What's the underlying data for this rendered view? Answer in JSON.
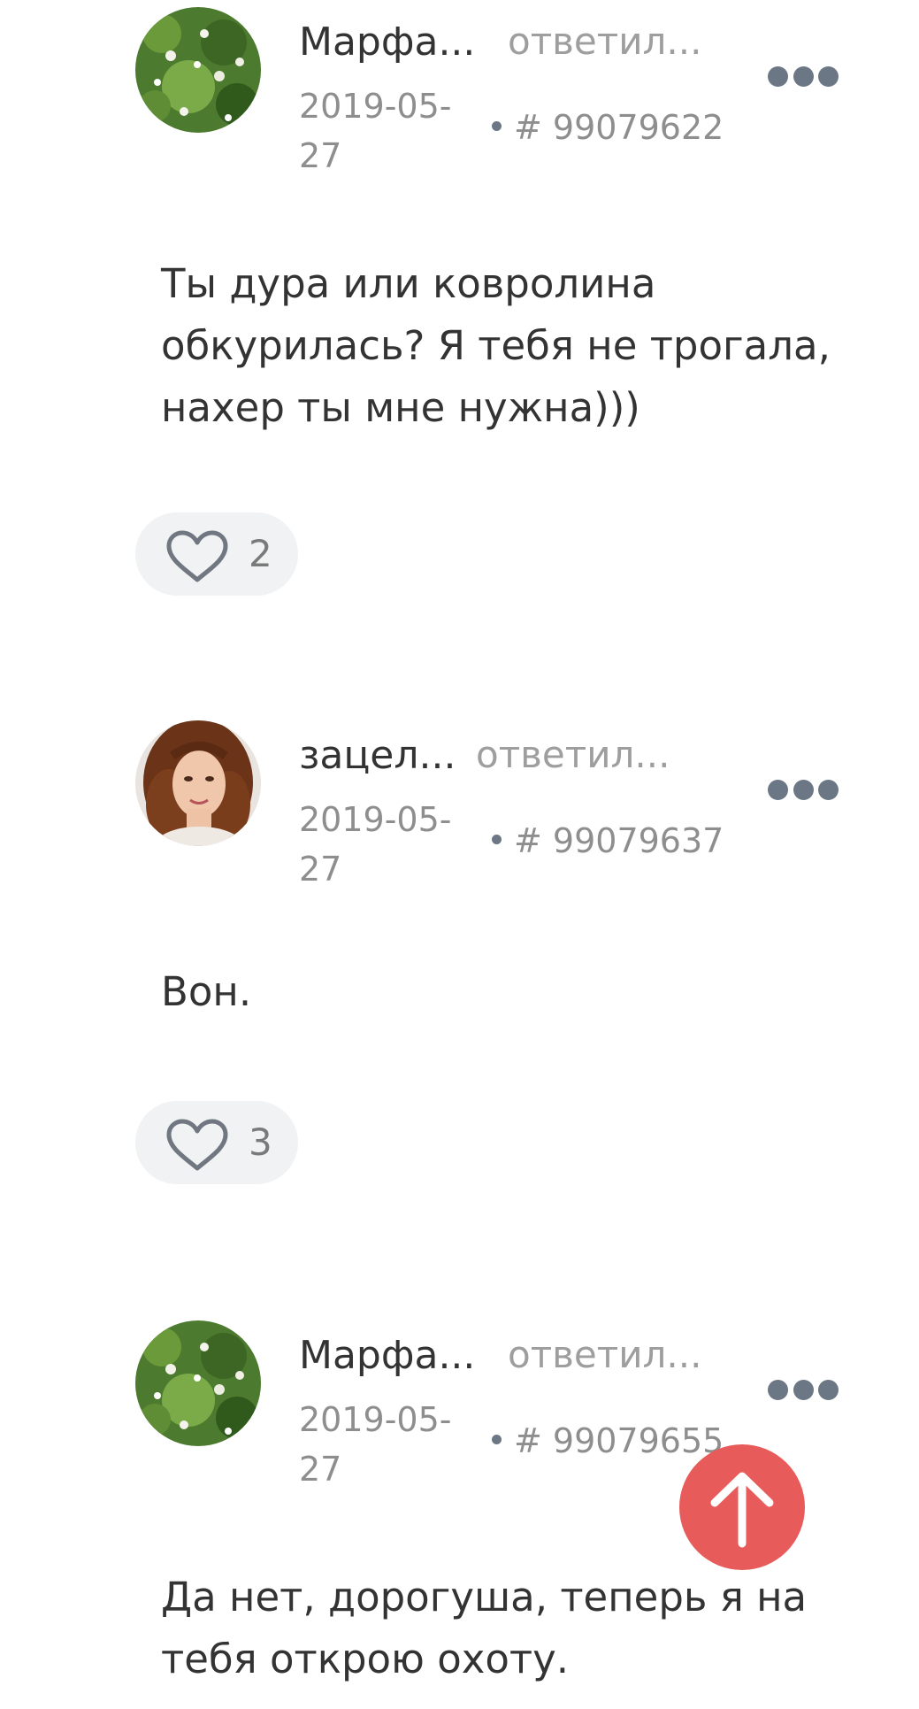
{
  "comments": [
    {
      "author": "Марфа...",
      "replied": "ответил...",
      "date": "2019-05-27",
      "id_text": "# 99079622",
      "text": "Ты дура или ковролина обкурилась? Я тебя не трогала, нахер ты мне нужна)))",
      "likes": "2",
      "avatar_icon": "green-plant-avatar"
    },
    {
      "author": "зацел...",
      "replied": "ответил...",
      "date": "2019-05-27",
      "id_text": "# 99079637",
      "text": "Вон.",
      "likes": "3",
      "avatar_icon": "woman-portrait-avatar"
    },
    {
      "author": "Марфа...",
      "replied": "ответил...",
      "date": "2019-05-27",
      "id_text": "# 99079655",
      "text": "Да нет, дорогуша, теперь я на тебя открою охоту.",
      "likes": null,
      "avatar_icon": "green-plant-avatar"
    }
  ],
  "icons": {
    "more": "more-dots-icon",
    "like": "heart-icon",
    "scroll_top": "arrow-up-icon"
  },
  "colors": {
    "accent_scroll_button": "#e85b5b",
    "more_dots": "#6b7785",
    "like_pill_bg": "#f0f2f3",
    "meta_text": "#8e8e8e"
  }
}
